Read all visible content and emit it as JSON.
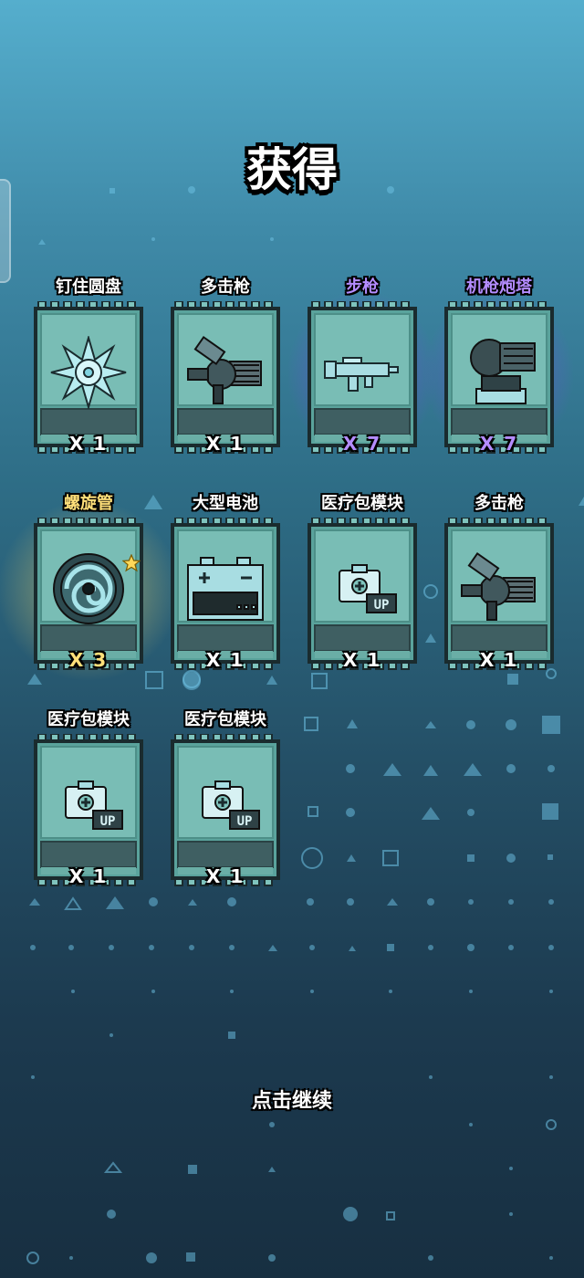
{
  "title": "获得",
  "continue_label": "点击继续",
  "colors": {
    "purple_rarity": "#b48cff",
    "gold_rarity": "#ffe07a",
    "normal": "#ffffff",
    "card_bg": "#6fb3ad"
  },
  "items": [
    {
      "name": "钉住圆盘",
      "count": "X 1",
      "icon": "spiked-disc-icon",
      "rarity": "normal"
    },
    {
      "name": "多击枪",
      "count": "X 1",
      "icon": "gatling-gun-icon",
      "rarity": "normal"
    },
    {
      "name": "步枪",
      "count": "X 7",
      "icon": "rifle-icon",
      "rarity": "purple"
    },
    {
      "name": "机枪炮塔",
      "count": "X 7",
      "icon": "machine-gun-turret-icon",
      "rarity": "purple"
    },
    {
      "name": "螺旋管",
      "count": "X 3",
      "icon": "spiral-tube-icon",
      "rarity": "gold"
    },
    {
      "name": "大型电池",
      "count": "X 1",
      "icon": "battery-icon",
      "rarity": "normal"
    },
    {
      "name": "医疗包模块",
      "count": "X 1",
      "icon": "medkit-module-icon",
      "rarity": "normal"
    },
    {
      "name": "多击枪",
      "count": "X 1",
      "icon": "gatling-gun-icon",
      "rarity": "normal"
    },
    {
      "name": "医疗包模块",
      "count": "X 1",
      "icon": "medkit-module-icon",
      "rarity": "normal"
    },
    {
      "name": "医疗包模块",
      "count": "X 1",
      "icon": "medkit-module-icon",
      "rarity": "normal"
    }
  ]
}
